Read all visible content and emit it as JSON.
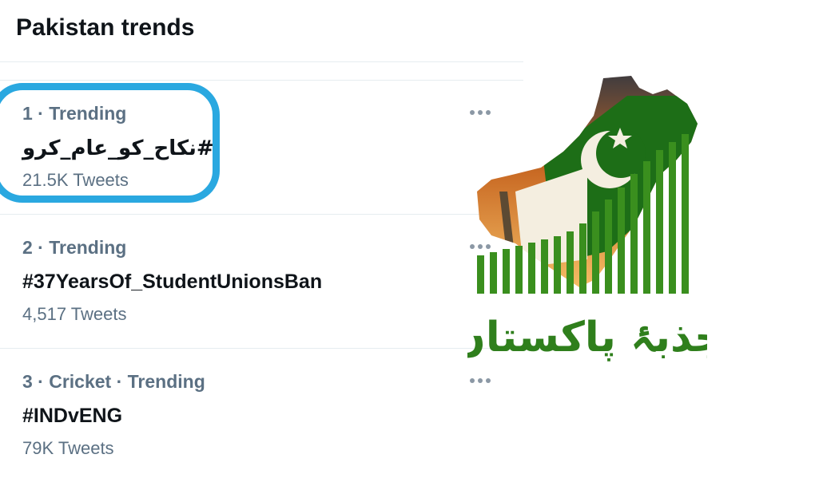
{
  "header": {
    "title": "Pakistan trends"
  },
  "trends": [
    {
      "meta": "1 · Trending",
      "name": "#نکاح_کو_عام_کرو",
      "count": "21.5K Tweets"
    },
    {
      "meta": "2 · Trending",
      "name": "#37YearsOf_StudentUnionsBan",
      "count": "4,517 Tweets"
    },
    {
      "meta": "3 · Cricket · Trending",
      "name": "#INDvENG",
      "count": "79K Tweets"
    }
  ],
  "logo": {
    "text": "جذبۂ پاکستان",
    "colors": {
      "green": "#3a8f1e",
      "dark_green": "#1c5a10",
      "sky": "#f3a243"
    }
  },
  "colors": {
    "highlight": "#2aa8e0",
    "secondary_text": "#5b7083",
    "primary_text": "#0f1419"
  },
  "icons": [
    "more-options-icon"
  ]
}
